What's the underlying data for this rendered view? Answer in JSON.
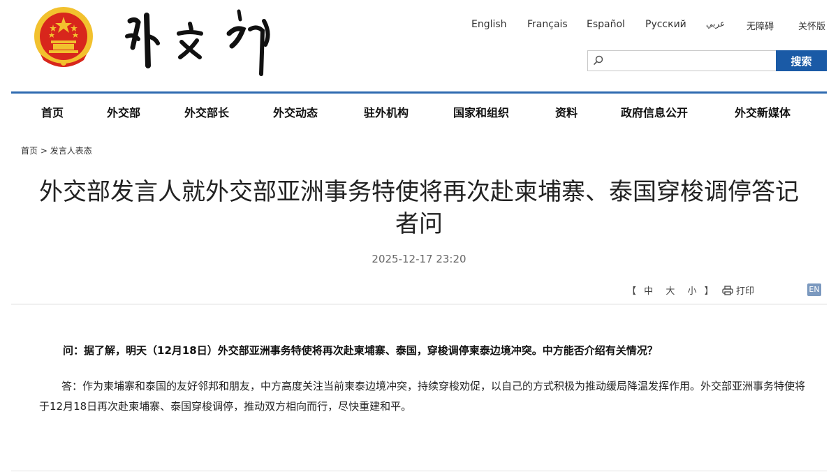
{
  "header": {
    "ministry_name": "外交部",
    "languages": [
      "English",
      "Français",
      "Español",
      "Русский",
      "عربي",
      "无障碍",
      "关怀版"
    ],
    "search": {
      "placeholder": "",
      "button_label": "搜索"
    }
  },
  "nav": {
    "items": [
      "首页",
      "外交部",
      "外交部长",
      "外交动态",
      "驻外机构",
      "国家和组织",
      "资料",
      "政府信息公开",
      "外交新媒体"
    ]
  },
  "breadcrumb": {
    "home": "首页",
    "separator": ">",
    "current": "发言人表态"
  },
  "article": {
    "title": "外交部发言人就外交部亚洲事务特使将再次赴柬埔寨、泰国穿梭调停答记者问",
    "datetime": "2025-12-17 23:20",
    "tools": {
      "bracket_open": "【",
      "size_large": "中",
      "size_medium": "大",
      "size_small": "小",
      "bracket_close": "】",
      "print_label": "打印",
      "en_label": "EN"
    },
    "question": "问：据了解，明天（12月18日）外交部亚洲事务特使将再次赴柬埔寨、泰国，穿梭调停柬泰边境冲突。中方能否介绍有关情况？",
    "answer": "答：作为柬埔寨和泰国的友好邻邦和朋友，中方高度关注当前柬泰边境冲突，持续穿梭劝促，以自己的方式积极为推动缓局降温发挥作用。外交部亚洲事务特使将于12月18日再次赴柬埔寨、泰国穿梭调停，推动双方相向而行，尽快重建和平。"
  },
  "colors": {
    "accent": "#1a5aa6",
    "rule": "#2e6ab0",
    "emblem_red": "#d8261c",
    "emblem_gold": "#f2c12e"
  }
}
